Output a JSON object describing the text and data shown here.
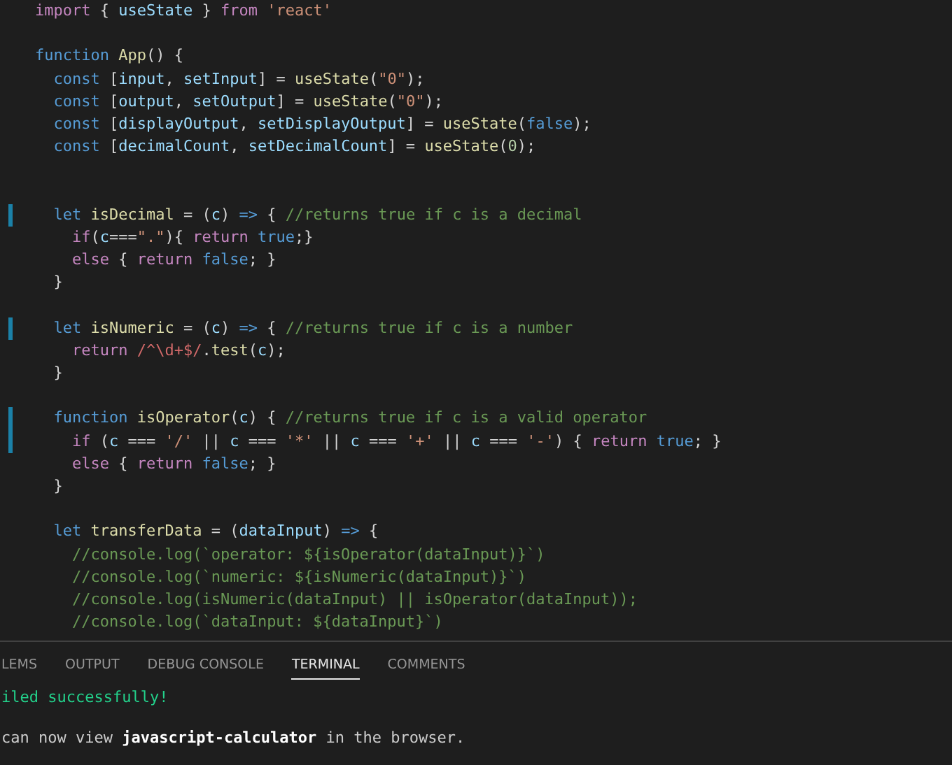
{
  "editor": {
    "lines": [
      {
        "modified": false,
        "tokens": [
          {
            "text": "import",
            "kind": "keyword"
          },
          {
            "text": " { ",
            "kind": "punct"
          },
          {
            "text": "useState",
            "kind": "variable"
          },
          {
            "text": " } ",
            "kind": "punct"
          },
          {
            "text": "from",
            "kind": "keyword"
          },
          {
            "text": " 'react'",
            "kind": "string"
          }
        ]
      },
      {
        "modified": false
      },
      {
        "modified": false,
        "tokens": [
          {
            "text": "function",
            "kind": "storage"
          },
          {
            "text": " App",
            "kind": "function"
          },
          {
            "text": "() {",
            "kind": "punct"
          }
        ]
      },
      {
        "modified": false,
        "tokens": [
          {
            "text": "  const",
            "kind": "storage"
          },
          {
            "text": " [",
            "kind": "punct"
          },
          {
            "text": "input",
            "kind": "variable"
          },
          {
            "text": ", ",
            "kind": "punct"
          },
          {
            "text": "setInput",
            "kind": "variable"
          },
          {
            "text": "] = ",
            "kind": "punct"
          },
          {
            "text": "useState",
            "kind": "function"
          },
          {
            "text": "(",
            "kind": "punct"
          },
          {
            "text": "\"0\"",
            "kind": "string"
          },
          {
            "text": ");",
            "kind": "punct"
          }
        ]
      },
      {
        "modified": false,
        "tokens": [
          {
            "text": "  const",
            "kind": "storage"
          },
          {
            "text": " [",
            "kind": "punct"
          },
          {
            "text": "output",
            "kind": "variable"
          },
          {
            "text": ", ",
            "kind": "punct"
          },
          {
            "text": "setOutput",
            "kind": "variable"
          },
          {
            "text": "] = ",
            "kind": "punct"
          },
          {
            "text": "useState",
            "kind": "function"
          },
          {
            "text": "(",
            "kind": "punct"
          },
          {
            "text": "\"0\"",
            "kind": "string"
          },
          {
            "text": ");",
            "kind": "punct"
          }
        ]
      },
      {
        "modified": false,
        "tokens": [
          {
            "text": "  const",
            "kind": "storage"
          },
          {
            "text": " [",
            "kind": "punct"
          },
          {
            "text": "displayOutput",
            "kind": "variable"
          },
          {
            "text": ", ",
            "kind": "punct"
          },
          {
            "text": "setDisplayOutput",
            "kind": "variable"
          },
          {
            "text": "] = ",
            "kind": "punct"
          },
          {
            "text": "useState",
            "kind": "function"
          },
          {
            "text": "(",
            "kind": "punct"
          },
          {
            "text": "false",
            "kind": "storage"
          },
          {
            "text": ");",
            "kind": "punct"
          }
        ]
      },
      {
        "modified": false,
        "tokens": [
          {
            "text": "  const",
            "kind": "storage"
          },
          {
            "text": " [",
            "kind": "punct"
          },
          {
            "text": "decimalCount",
            "kind": "variable"
          },
          {
            "text": ", ",
            "kind": "punct"
          },
          {
            "text": "setDecimalCount",
            "kind": "variable"
          },
          {
            "text": "] = ",
            "kind": "punct"
          },
          {
            "text": "useState",
            "kind": "function"
          },
          {
            "text": "(",
            "kind": "punct"
          },
          {
            "text": "0",
            "kind": "number"
          },
          {
            "text": ");",
            "kind": "punct"
          }
        ]
      },
      {
        "modified": false
      },
      {
        "modified": false
      },
      {
        "modified": true,
        "tokens": [
          {
            "text": "  let",
            "kind": "storage"
          },
          {
            "text": " isDecimal",
            "kind": "function"
          },
          {
            "text": " = (",
            "kind": "punct"
          },
          {
            "text": "c",
            "kind": "variable"
          },
          {
            "text": ") ",
            "kind": "punct"
          },
          {
            "text": "=>",
            "kind": "storage"
          },
          {
            "text": " { ",
            "kind": "punct"
          },
          {
            "text": "//returns true if c is a decimal",
            "kind": "comment"
          }
        ]
      },
      {
        "modified": false,
        "tokens": [
          {
            "text": "    if",
            "kind": "keyword"
          },
          {
            "text": "(",
            "kind": "punct"
          },
          {
            "text": "c",
            "kind": "variable"
          },
          {
            "text": "===",
            "kind": "punct"
          },
          {
            "text": "\".\"",
            "kind": "string"
          },
          {
            "text": "){ ",
            "kind": "punct"
          },
          {
            "text": "return",
            "kind": "keyword"
          },
          {
            "text": " true",
            "kind": "storage"
          },
          {
            "text": ";}",
            "kind": "punct"
          }
        ]
      },
      {
        "modified": false,
        "tokens": [
          {
            "text": "    else",
            "kind": "keyword"
          },
          {
            "text": " { ",
            "kind": "punct"
          },
          {
            "text": "return",
            "kind": "keyword"
          },
          {
            "text": " false",
            "kind": "storage"
          },
          {
            "text": "; }",
            "kind": "punct"
          }
        ]
      },
      {
        "modified": false,
        "tokens": [
          {
            "text": "  }",
            "kind": "punct"
          }
        ]
      },
      {
        "modified": false
      },
      {
        "modified": true,
        "tokens": [
          {
            "text": "  let",
            "kind": "storage"
          },
          {
            "text": " isNumeric",
            "kind": "function"
          },
          {
            "text": " = (",
            "kind": "punct"
          },
          {
            "text": "c",
            "kind": "variable"
          },
          {
            "text": ") ",
            "kind": "punct"
          },
          {
            "text": "=>",
            "kind": "storage"
          },
          {
            "text": " { ",
            "kind": "punct"
          },
          {
            "text": "//returns true if c is a number",
            "kind": "comment"
          }
        ]
      },
      {
        "modified": false,
        "tokens": [
          {
            "text": "    return",
            "kind": "keyword"
          },
          {
            "text": " /^\\d+$/",
            "kind": "regex"
          },
          {
            "text": ".",
            "kind": "punct"
          },
          {
            "text": "test",
            "kind": "function"
          },
          {
            "text": "(",
            "kind": "punct"
          },
          {
            "text": "c",
            "kind": "variable"
          },
          {
            "text": ");",
            "kind": "punct"
          }
        ]
      },
      {
        "modified": false,
        "tokens": [
          {
            "text": "  }",
            "kind": "punct"
          }
        ]
      },
      {
        "modified": false
      },
      {
        "modified": true,
        "tokens": [
          {
            "text": "  function",
            "kind": "storage"
          },
          {
            "text": " isOperator",
            "kind": "function"
          },
          {
            "text": "(",
            "kind": "punct"
          },
          {
            "text": "c",
            "kind": "variable"
          },
          {
            "text": ") { ",
            "kind": "punct"
          },
          {
            "text": "//returns true if c is a valid operator",
            "kind": "comment"
          }
        ]
      },
      {
        "modified": true,
        "tokens": [
          {
            "text": "    if",
            "kind": "keyword"
          },
          {
            "text": " (",
            "kind": "punct"
          },
          {
            "text": "c",
            "kind": "variable"
          },
          {
            "text": " === ",
            "kind": "punct"
          },
          {
            "text": "'/'",
            "kind": "string"
          },
          {
            "text": " || ",
            "kind": "punct"
          },
          {
            "text": "c",
            "kind": "variable"
          },
          {
            "text": " === ",
            "kind": "punct"
          },
          {
            "text": "'*'",
            "kind": "string"
          },
          {
            "text": " || ",
            "kind": "punct"
          },
          {
            "text": "c",
            "kind": "variable"
          },
          {
            "text": " === ",
            "kind": "punct"
          },
          {
            "text": "'+'",
            "kind": "string"
          },
          {
            "text": " || ",
            "kind": "punct"
          },
          {
            "text": "c",
            "kind": "variable"
          },
          {
            "text": " === ",
            "kind": "punct"
          },
          {
            "text": "'-'",
            "kind": "string"
          },
          {
            "text": ") { ",
            "kind": "punct"
          },
          {
            "text": "return",
            "kind": "keyword"
          },
          {
            "text": " true",
            "kind": "storage"
          },
          {
            "text": "; }",
            "kind": "punct"
          }
        ]
      },
      {
        "modified": false,
        "tokens": [
          {
            "text": "    else",
            "kind": "keyword"
          },
          {
            "text": " { ",
            "kind": "punct"
          },
          {
            "text": "return",
            "kind": "keyword"
          },
          {
            "text": " false",
            "kind": "storage"
          },
          {
            "text": "; }",
            "kind": "punct"
          }
        ]
      },
      {
        "modified": false,
        "tokens": [
          {
            "text": "  }",
            "kind": "punct"
          }
        ]
      },
      {
        "modified": false
      },
      {
        "modified": false,
        "tokens": [
          {
            "text": "  let",
            "kind": "storage"
          },
          {
            "text": " transferData",
            "kind": "function"
          },
          {
            "text": " = (",
            "kind": "punct"
          },
          {
            "text": "dataInput",
            "kind": "variable"
          },
          {
            "text": ") ",
            "kind": "punct"
          },
          {
            "text": "=>",
            "kind": "storage"
          },
          {
            "text": " {",
            "kind": "punct"
          }
        ]
      },
      {
        "modified": false,
        "tokens": [
          {
            "text": "    //console.log(`operator: ${isOperator(dataInput)}`)",
            "kind": "comment"
          }
        ]
      },
      {
        "modified": false,
        "tokens": [
          {
            "text": "    //console.log(`numeric: ${isNumeric(dataInput)}`)",
            "kind": "comment"
          }
        ]
      },
      {
        "modified": false,
        "tokens": [
          {
            "text": "    //console.log(isNumeric(dataInput) || isOperator(dataInput));",
            "kind": "comment"
          }
        ]
      },
      {
        "modified": false,
        "tokens": [
          {
            "text": "    //console.log(`dataInput: ${dataInput}`)",
            "kind": "comment"
          }
        ]
      }
    ]
  },
  "panel": {
    "tabs": [
      {
        "label": "LEMS",
        "selected": false
      },
      {
        "label": "OUTPUT",
        "selected": false
      },
      {
        "label": "DEBUG CONSOLE",
        "selected": false
      },
      {
        "label": "TERMINAL",
        "selected": true
      },
      {
        "label": "COMMENTS",
        "selected": false
      }
    ],
    "terminal_lines": [
      {
        "kind": "success",
        "text": "iled successfully!"
      },
      {
        "kind": "plain",
        "text": "can now view **javascript-calculator** in the browser."
      }
    ]
  }
}
